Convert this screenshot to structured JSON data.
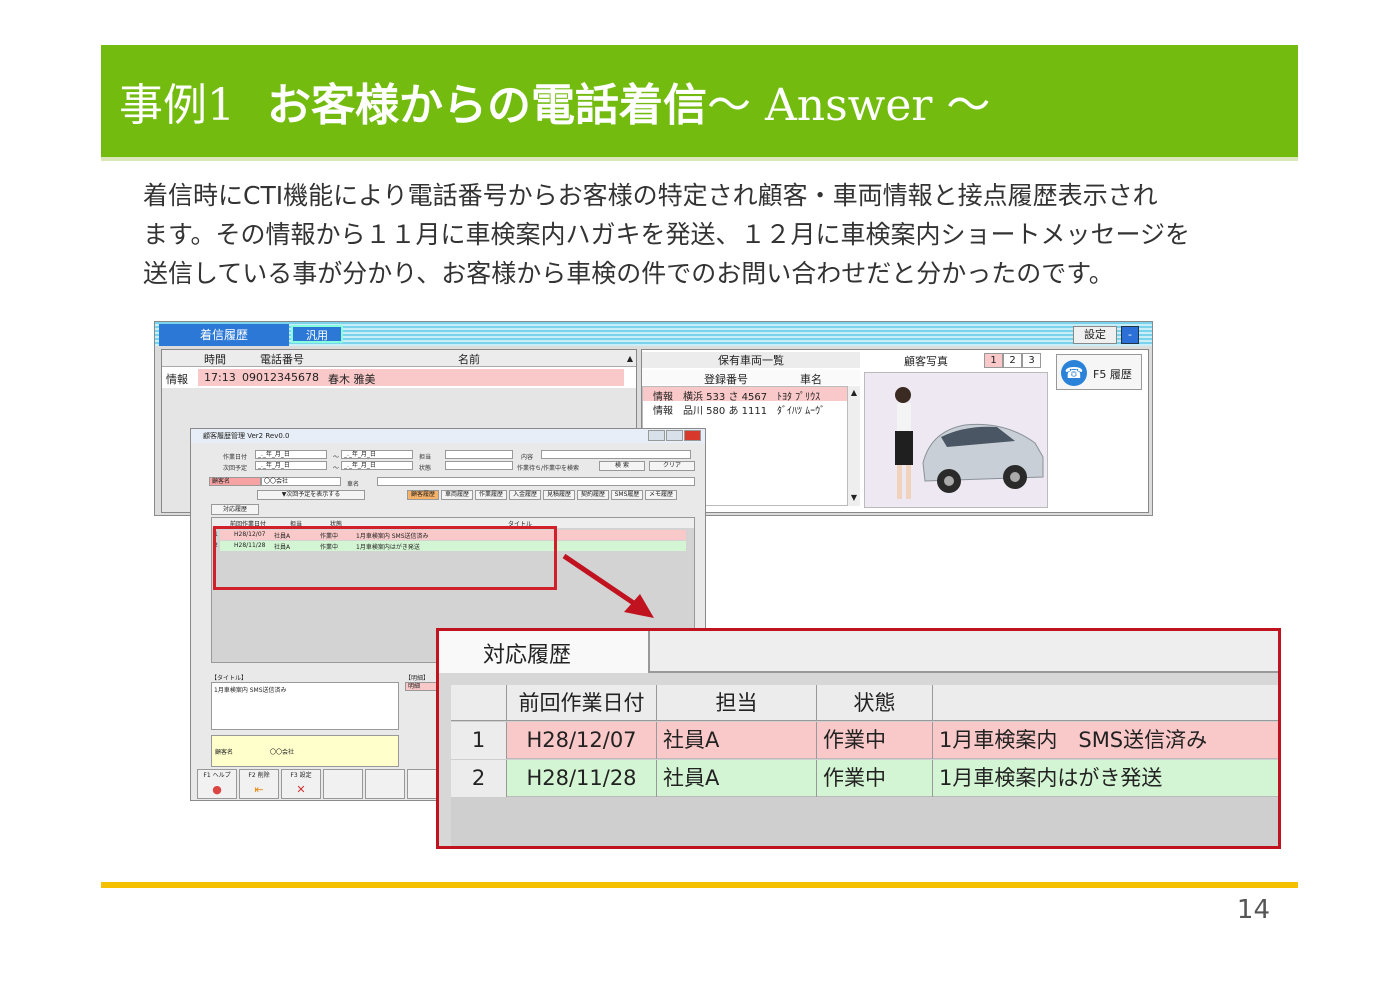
{
  "slide": {
    "title_prefix": "事例1",
    "title_main": "お客様からの電話着信",
    "title_suffix": "～ Answer ～",
    "paragraph_lines": [
      "着信時にCTI機能により電話番号からお客様の特定され顧客・車両情報と接点履歴表示され",
      "ます。その情報から１１月に車検案内ハガキを発送、１２月に車検案内ショートメッセージを",
      "送信している事が分かり、お客様から車検の件でのお問い合わせだと分かったのです。"
    ],
    "page_number": "14"
  },
  "cti": {
    "tab_active": "着信履歴",
    "tab_inactive": "汎用",
    "setting": "設定",
    "min": "-",
    "call_headers": [
      "時間",
      "電話番号",
      "名前"
    ],
    "call_row": {
      "tag": "情報",
      "time": "17:13",
      "phone": "09012345678",
      "name": "春木 雅美"
    },
    "vehicle_title": "保有車両一覧",
    "vehicle_headers": [
      "登録番号",
      "車名"
    ],
    "vehicles": [
      {
        "tag": "情報",
        "reg": "横浜 533 さ 4567",
        "car": "ﾄﾖﾀ ﾌﾟﾘｳｽ"
      },
      {
        "tag": "情報",
        "reg": "品川 580 あ 1111",
        "car": "ﾀﾞｲﾊﾂ ﾑｰｳﾞ"
      }
    ],
    "photo_label": "顧客写真",
    "photo_tabs": [
      "1",
      "2",
      "3"
    ],
    "history_button": "F5 履歴"
  },
  "cust": {
    "window_title": "顧客履歴管理 Ver2 Rev0.0",
    "work_date_label": "作業日付",
    "next_label": "次回予定",
    "date_placeholder": "_._年_月_日",
    "tilde": "～",
    "staff_label": "担当",
    "status_label": "状態",
    "content_label": "内容",
    "checkbox_label": "作業待ち/作業中を検索",
    "search_btn": "検 索",
    "clear_btn": "クリア",
    "customer_label": "顧客名",
    "customer_value": "〇〇会社",
    "car_label": "車名",
    "show_next_btn": "▼次回予定を表示する",
    "history_tabs": [
      "顧客履歴",
      "車両履歴",
      "作業履歴",
      "入金履歴",
      "見積履歴",
      "契約履歴",
      "SMS履歴",
      "メモ履歴"
    ],
    "inner_tab": "対応履歴",
    "grid_headers": [
      "前回作業日付",
      "担当",
      "状態",
      "タイトル"
    ],
    "rows": [
      {
        "no": "1",
        "date": "H28/12/07",
        "staff": "社員A",
        "status": "作業中",
        "title": "1月車検案内 SMS送信済み"
      },
      {
        "no": "2",
        "date": "H28/11/28",
        "staff": "社員A",
        "status": "作業中",
        "title": "1月車検案内はがき発送"
      }
    ],
    "title_label": "【タイトル】",
    "detail_label": "【明細】",
    "detail_col": "明細",
    "memo_text": "1月車検案内 SMS送信済み",
    "yellow_label": "顧客名",
    "yellow_value": "〇〇会社",
    "fkeys": [
      {
        "label": "F1 ヘルプ",
        "icon": "help-icon"
      },
      {
        "label": "F2 削除",
        "icon": "delete-icon"
      },
      {
        "label": "F3 設定",
        "icon": "settings-icon"
      }
    ]
  },
  "zoom": {
    "tab": "対応履歴",
    "headers": [
      "前回作業日付",
      "担当",
      "状態",
      ""
    ],
    "rows": [
      {
        "no": "1",
        "date": "H28/12/07",
        "staff": "社員A",
        "status": "作業中",
        "title": "1月車検案内　SMS送信済み",
        "color": "#f9c8c8"
      },
      {
        "no": "2",
        "date": "H28/11/28",
        "staff": "社員A",
        "status": "作業中",
        "title": "1月車検案内はがき発送",
        "color": "#d4f5d4"
      }
    ]
  },
  "colors": {
    "title_green": "#73bc0f",
    "footer_yellow": "#f5c000",
    "highlight_red": "#c0121f",
    "row_pink": "#f9c8c8",
    "row_green": "#d4f5d4"
  }
}
